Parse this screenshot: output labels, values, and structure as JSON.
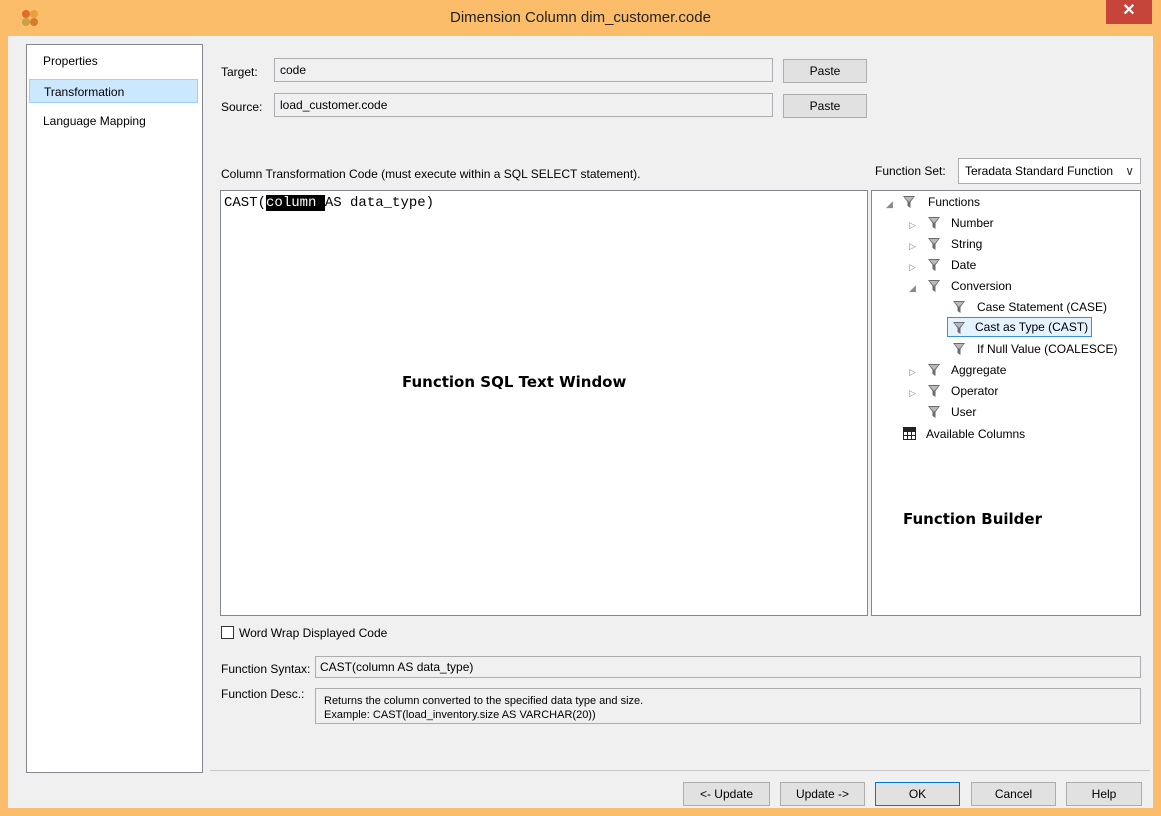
{
  "window": {
    "title": "Dimension Column dim_customer.code",
    "close_glyph": "✕",
    "icon": "app-icon"
  },
  "nav": {
    "items": [
      {
        "label": "Properties",
        "selected": false
      },
      {
        "label": "Transformation",
        "selected": true
      },
      {
        "label": "Language Mapping",
        "selected": false
      }
    ]
  },
  "target": {
    "label": "Target:",
    "value": "code",
    "paste_label": "Paste"
  },
  "source": {
    "label": "Source:",
    "value": "load_customer.code",
    "paste_label": "Paste"
  },
  "code": {
    "heading": "Column Transformation Code (must execute within a SQL SELECT statement).",
    "prefix": "CAST(",
    "highlight": "column ",
    "suffix": "AS data_type)",
    "overlay_label": "Function SQL Text Window"
  },
  "function_set": {
    "label": "Function Set:",
    "selected": "Teradata Standard Function"
  },
  "tree": {
    "root": "Functions",
    "number": "Number",
    "string": "String",
    "date": "Date",
    "conversion": "Conversion",
    "case": "Case Statement (CASE)",
    "cast": "Cast as Type (CAST)",
    "coalesce": "If Null Value (COALESCE)",
    "aggregate": "Aggregate",
    "operator": "Operator",
    "user": "User",
    "available_columns": "Available Columns",
    "overlay_label": "Function Builder"
  },
  "word_wrap": {
    "label": "Word Wrap Displayed Code",
    "checked": false
  },
  "syntax": {
    "label": "Function Syntax:",
    "value": "CAST(column AS data_type)"
  },
  "desc": {
    "label": "Function Desc.:",
    "line1": "Returns the column converted to the specified data type and size.",
    "line2": "Example: CAST(load_inventory.size AS VARCHAR(20))"
  },
  "buttons": {
    "update_back": "<- Update",
    "update_fwd": "Update ->",
    "ok": "OK",
    "cancel": "Cancel",
    "help": "Help"
  },
  "colors": {
    "titlebar": "#fcbd6a",
    "selection": "#cce8ff",
    "close": "#c7443b"
  }
}
